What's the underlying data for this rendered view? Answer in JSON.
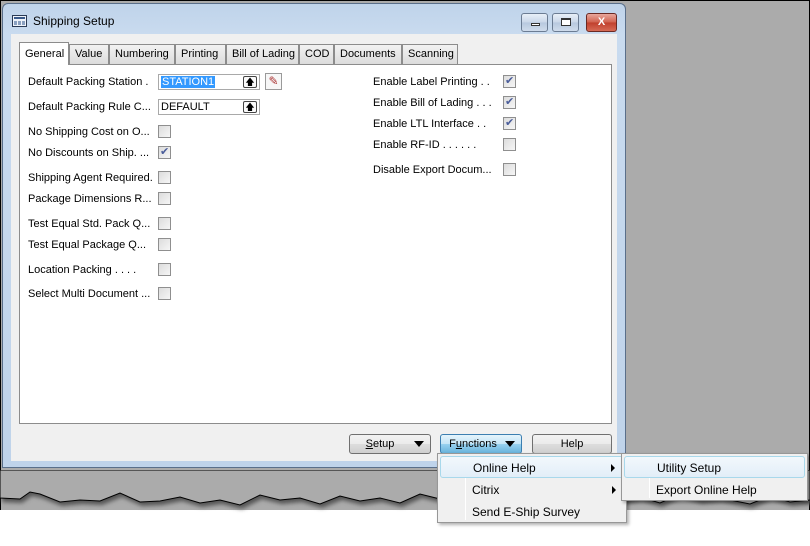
{
  "window": {
    "title": "Shipping Setup",
    "minimize_label": "",
    "maximize_label": "",
    "close_label": "X"
  },
  "tabs": [
    {
      "label": "General",
      "active": true
    },
    {
      "label": "Value"
    },
    {
      "label": "Numbering"
    },
    {
      "label": "Printing"
    },
    {
      "label": "Bill of Lading"
    },
    {
      "label": "COD"
    },
    {
      "label": "Documents"
    },
    {
      "label": "Scanning"
    }
  ],
  "general": {
    "default_packing_station": {
      "label": "Default Packing Station  .",
      "value": "STATION1"
    },
    "default_packing_rule": {
      "label": "Default Packing Rule C...",
      "value": "DEFAULT"
    },
    "left_checkboxes": [
      {
        "label": "No Shipping Cost on O...",
        "checked": false
      },
      {
        "label": "No Discounts on Ship. ...",
        "checked": true
      },
      {
        "label": "Shipping Agent Required.",
        "checked": false
      },
      {
        "label": "Package Dimensions R...",
        "checked": false
      },
      {
        "label": "Test Equal Std. Pack Q...",
        "checked": false
      },
      {
        "label": "Test Equal Package Q...",
        "checked": false
      },
      {
        "label": "Location Packing  . . . .",
        "checked": false
      },
      {
        "label": "Select Multi Document ...",
        "checked": false
      }
    ],
    "right_checkboxes": [
      {
        "label": "Enable Label Printing  . .",
        "checked": true
      },
      {
        "label": "Enable Bill of Lading . . .",
        "checked": true
      },
      {
        "label": "Enable LTL Interface  . .",
        "checked": true
      },
      {
        "label": "Enable RF-ID . . . . . .",
        "checked": false
      },
      {
        "label": "Disable Export Docum...",
        "checked": false
      }
    ]
  },
  "buttons": {
    "setup": {
      "prefix": "",
      "accel": "S",
      "rest": "etup"
    },
    "functions": {
      "prefix": "F",
      "accel": "u",
      "rest": "nctions"
    },
    "help": "Help"
  },
  "functions_menu": [
    {
      "label": "Online Help",
      "submenu": true,
      "highlighted": true
    },
    {
      "label": "Citrix",
      "submenu": true
    },
    {
      "label": "Send E-Ship Survey",
      "submenu": false
    }
  ],
  "online_help_submenu": [
    {
      "label": "Utility Setup",
      "highlighted": true
    },
    {
      "label": "Export Online Help"
    }
  ]
}
